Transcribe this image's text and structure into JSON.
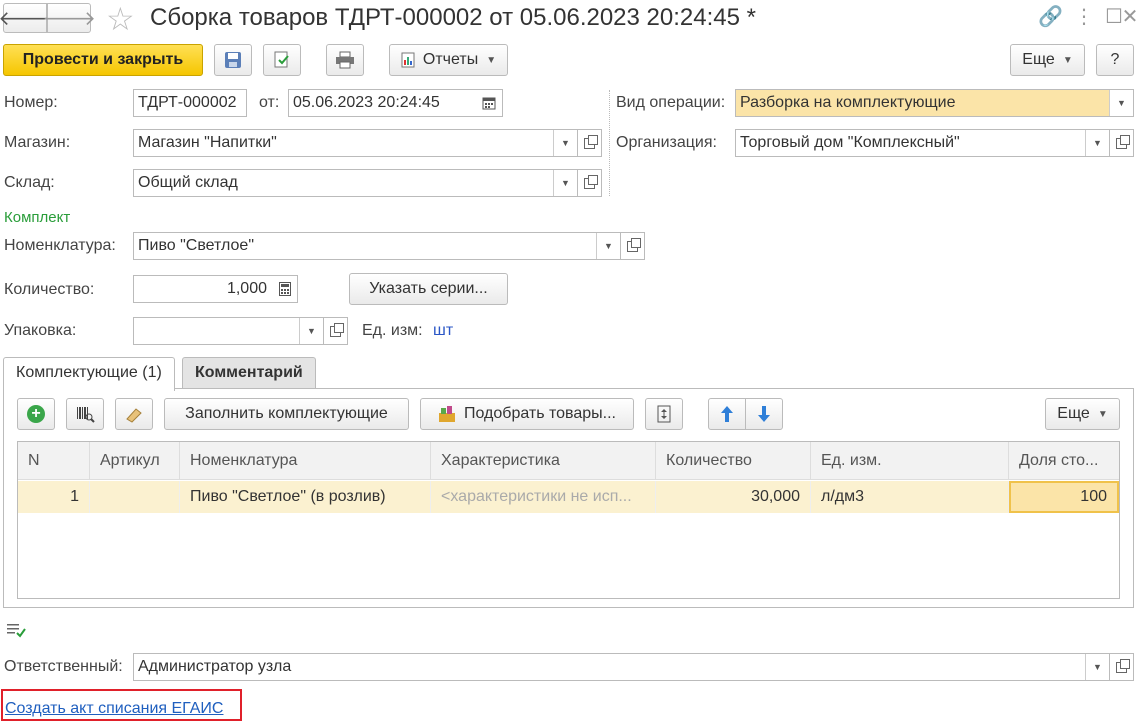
{
  "window": {
    "title": "Сборка товаров ТДРТ-000002 от 05.06.2023 20:24:45 *",
    "nav_back_icon": "arrow-left-icon",
    "nav_forward_icon": "arrow-right-icon",
    "favorite_icon": "star-icon"
  },
  "toolbar": {
    "post_close_label": "Провести и закрыть",
    "reports_label": "Отчеты",
    "more_label": "Еще",
    "help_label": "?"
  },
  "header": {
    "number_label": "Номер:",
    "number_value": "ТДРТ-000002",
    "date_label": "от:",
    "date_value": "05.06.2023 20:24:45",
    "store_label": "Магазин:",
    "store_value": "Магазин \"Напитки\"",
    "warehouse_label": "Склад:",
    "warehouse_value": "Общий склад",
    "operation_label": "Вид операции:",
    "operation_value": "Разборка на комплектующие",
    "org_label": "Организация:",
    "org_value": "Торговый дом \"Комплексный\""
  },
  "kit": {
    "section_label": "Комплект",
    "item_label": "Номенклатура:",
    "item_value": "Пиво \"Светлое\"",
    "qty_label": "Количество:",
    "qty_value": "1,000",
    "series_button": "Указать серии...",
    "pack_label": "Упаковка:",
    "pack_value": "",
    "unit_label": "Ед. изм:",
    "unit_value": "шт"
  },
  "tabs": [
    {
      "label": "Комплектующие (1)",
      "active": true
    },
    {
      "label": "Комментарий",
      "active": false
    }
  ],
  "components": {
    "fill_button": "Заполнить комплектующие",
    "pick_button": "Подобрать товары...",
    "more_label": "Еще",
    "columns": [
      "N",
      "Артикул",
      "Номенклатура",
      "Характеристика",
      "Количество",
      "Ед. изм.",
      "Доля сто..."
    ],
    "rows": [
      {
        "n": "1",
        "article": "",
        "item": "Пиво \"Светлое\" (в розлив)",
        "characteristic": "<характеристики не исп...",
        "qty": "30,000",
        "unit": "л/дм3",
        "share": "100"
      }
    ]
  },
  "footer": {
    "responsible_label": "Ответственный:",
    "responsible_value": "Администратор узла",
    "egais_link": "Создать акт списания ЕГАИС"
  }
}
